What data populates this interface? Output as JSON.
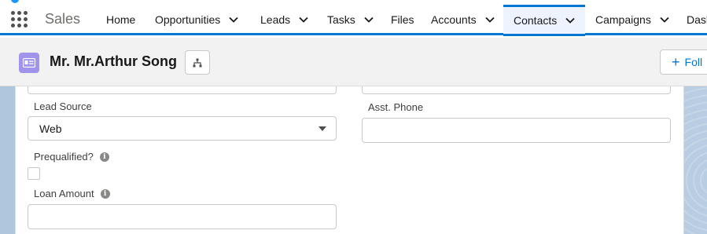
{
  "app": {
    "name": "Sales"
  },
  "nav": {
    "items": [
      {
        "label": "Home",
        "has_menu": false
      },
      {
        "label": "Opportunities",
        "has_menu": true
      },
      {
        "label": "Leads",
        "has_menu": true
      },
      {
        "label": "Tasks",
        "has_menu": true
      },
      {
        "label": "Files",
        "has_menu": false
      },
      {
        "label": "Accounts",
        "has_menu": true
      },
      {
        "label": "Contacts",
        "has_menu": true,
        "active": true
      },
      {
        "label": "Campaigns",
        "has_menu": true
      },
      {
        "label": "Dash",
        "has_menu": false
      }
    ]
  },
  "record": {
    "title": "Mr. Mr.Arthur Song",
    "icon": "contact-card-icon",
    "icon_color": "#a094ed",
    "follow_label": "Foll"
  },
  "form": {
    "lead_source": {
      "label": "Lead Source",
      "value": "Web"
    },
    "asst_phone": {
      "label": "Asst. Phone",
      "value": ""
    },
    "prequalified": {
      "label": "Prequalified?",
      "checked": false
    },
    "loan_amount": {
      "label": "Loan Amount",
      "value": ""
    }
  },
  "colors": {
    "brand": "#0176d3",
    "active_tab_bg": "#eef4ff"
  }
}
